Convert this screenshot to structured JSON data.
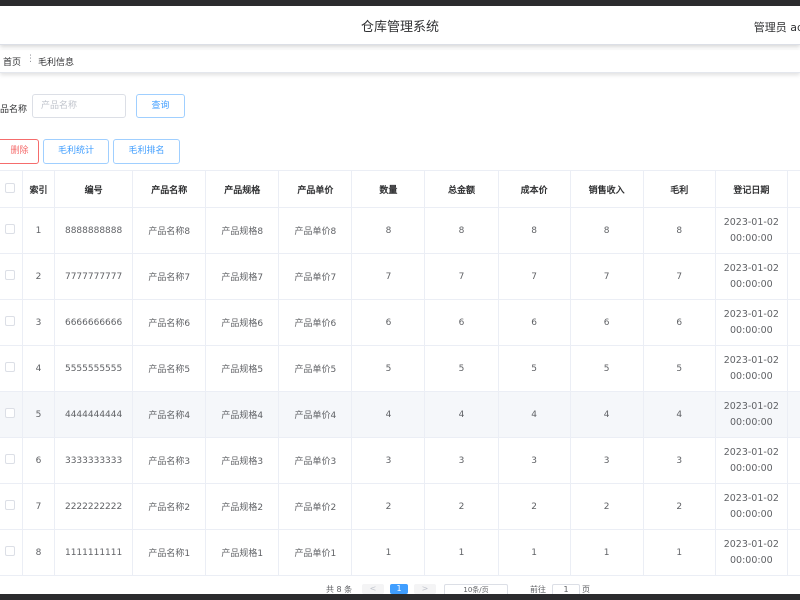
{
  "header": {
    "title": "仓库管理系统",
    "user": "管理员 ad"
  },
  "breadcrumb": {
    "home": "首页",
    "separator": "⋮",
    "current": "毛利信息"
  },
  "search": {
    "label": "品名称",
    "placeholder": "产品名称",
    "value": "",
    "query_label": "查询"
  },
  "toolbar": {
    "delete_label": "删除",
    "stat_label": "毛利统计",
    "rank_label": "毛利排名"
  },
  "table": {
    "columns": [
      "",
      "索引",
      "编号",
      "产品名称",
      "产品规格",
      "产品单价",
      "数量",
      "总金额",
      "成本价",
      "销售收入",
      "毛利",
      "登记日期",
      ""
    ],
    "rows": [
      [
        "1",
        "8888888888",
        "产品名称8",
        "产品规格8",
        "产品单价8",
        "8",
        "8",
        "8",
        "8",
        "8",
        "2023-01-02 00:00:00"
      ],
      [
        "2",
        "7777777777",
        "产品名称7",
        "产品规格7",
        "产品单价7",
        "7",
        "7",
        "7",
        "7",
        "7",
        "2023-01-02 00:00:00"
      ],
      [
        "3",
        "6666666666",
        "产品名称6",
        "产品规格6",
        "产品单价6",
        "6",
        "6",
        "6",
        "6",
        "6",
        "2023-01-02 00:00:00"
      ],
      [
        "4",
        "5555555555",
        "产品名称5",
        "产品规格5",
        "产品单价5",
        "5",
        "5",
        "5",
        "5",
        "5",
        "2023-01-02 00:00:00"
      ],
      [
        "5",
        "4444444444",
        "产品名称4",
        "产品规格4",
        "产品单价4",
        "4",
        "4",
        "4",
        "4",
        "4",
        "2023-01-02 00:00:00"
      ],
      [
        "6",
        "3333333333",
        "产品名称3",
        "产品规格3",
        "产品单价3",
        "3",
        "3",
        "3",
        "3",
        "3",
        "2023-01-02 00:00:00"
      ],
      [
        "7",
        "2222222222",
        "产品名称2",
        "产品规格2",
        "产品单价2",
        "2",
        "2",
        "2",
        "2",
        "2",
        "2023-01-02 00:00:00"
      ],
      [
        "8",
        "1111111111",
        "产品名称1",
        "产品规格1",
        "产品单价1",
        "1",
        "1",
        "1",
        "1",
        "1",
        "2023-01-02 00:00:00"
      ]
    ],
    "highlighted_row": 4
  },
  "pagination": {
    "total": "共 8 条",
    "prev": "<",
    "page": "1",
    "next": ">",
    "page_size": "10条/页",
    "goto": "前往",
    "goto_value": "1",
    "unit": "页"
  },
  "colors": {
    "primary": "#409eff",
    "danger": "#f56c6c",
    "border": "#ebeef5",
    "frame": "#2b2b2e"
  }
}
